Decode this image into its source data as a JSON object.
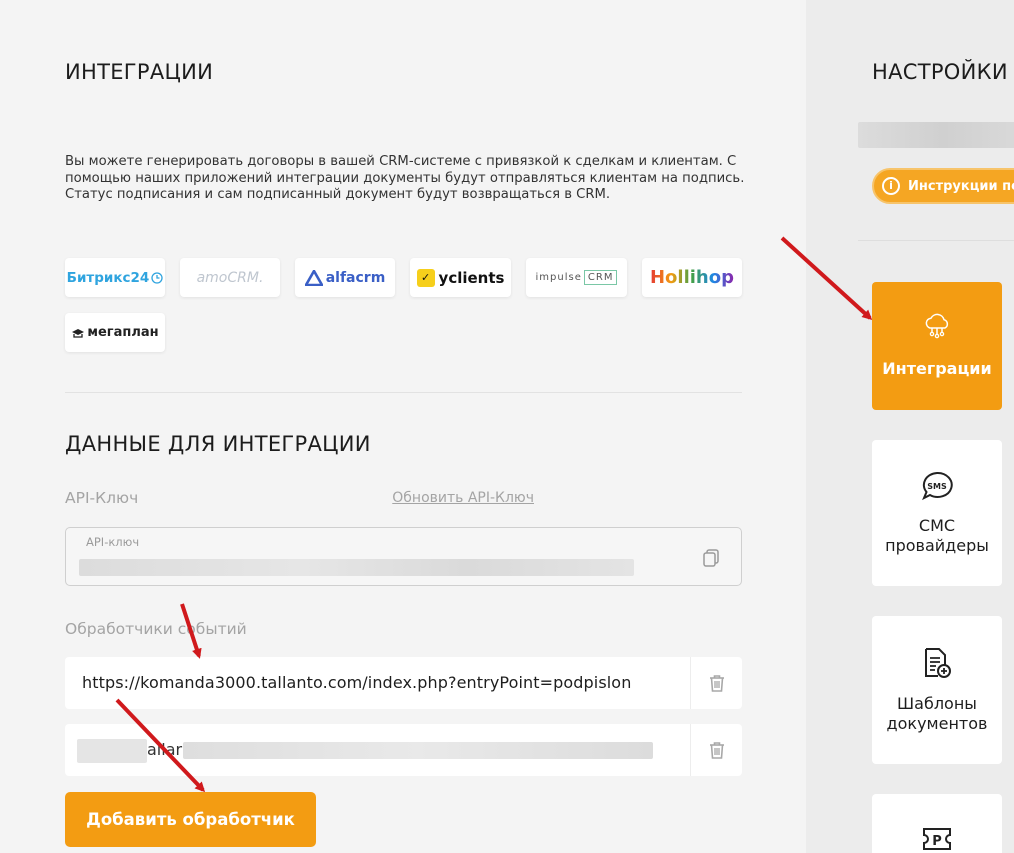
{
  "main": {
    "title": "ИНТЕГРАЦИИ",
    "description": "Вы можете генерировать договоры в вашей CRM-системе с привязкой к сделкам и клиентам. С помощью наших приложений интеграции документы будут отправляться клиентам на подпись. Статус подписания и сам подписанный документ будут возвращаться в CRM.",
    "logos": {
      "bitrix": "Битрикс24",
      "amo": "amoCRM.",
      "alfa": "alfacrm",
      "yclients": "yclients",
      "impulse_a": "impulse",
      "impulse_b": "CRM",
      "hollihop": "Hollihop",
      "megaplan": "мегаплан"
    },
    "integration_title": "ДАННЫЕ ДЛЯ ИНТЕГРАЦИИ",
    "api_label": "API-Ключ",
    "refresh_link": "Обновить API-Ключ",
    "api_field_label": "API-ключ",
    "handlers_label": "Обработчики событий",
    "handlers": [
      {
        "url": "https://komanda3000.tallanto.com/index.php?entryPoint=podpislon"
      },
      {
        "url": "allar"
      }
    ],
    "add_button": "Добавить обработчик"
  },
  "sidebar": {
    "title": "НАСТРОЙКИ",
    "instructions_button": "Инструкции по",
    "cards": [
      {
        "label": "Интеграции",
        "icon": "cloud-network-icon",
        "active": true
      },
      {
        "label": "СМС провайдеры",
        "icon": "sms-bubble-icon",
        "active": false
      },
      {
        "label": "Шаблоны документов",
        "icon": "document-add-icon",
        "active": false
      },
      {
        "label": "",
        "icon": "parking-ticket-icon",
        "active": false
      }
    ]
  },
  "colors": {
    "accent": "#f39c12",
    "arrow": "#d0191c"
  }
}
